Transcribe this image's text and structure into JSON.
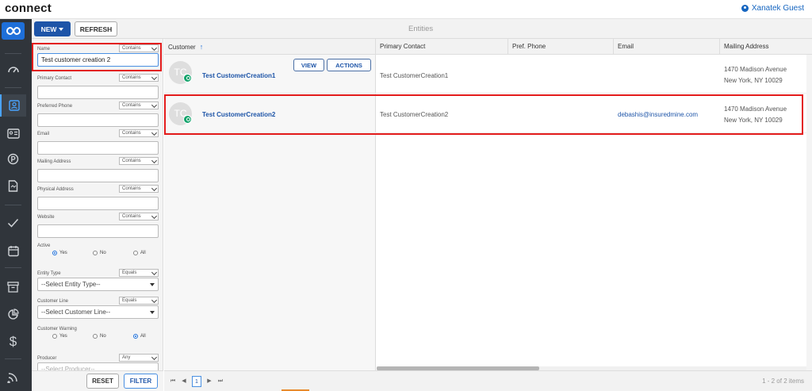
{
  "app": {
    "logo": "connect",
    "user_name": "Xanatek Guest"
  },
  "toolbar": {
    "new_label": "NEW",
    "refresh_label": "REFRESH",
    "title": "Entities"
  },
  "rail_icons": [
    "dashboard-icon",
    "contacts-icon",
    "id-card-icon",
    "policy-icon",
    "document-icon",
    "check-icon",
    "calendar-icon",
    "archive-icon",
    "reports-icon",
    "dollar-icon",
    "signal-icon"
  ],
  "filters": {
    "name": {
      "label": "Name",
      "op": "Contains",
      "value": "Test  customer creation 2"
    },
    "primary_contact": {
      "label": "Primary Contact",
      "op": "Contains",
      "value": ""
    },
    "preferred_phone": {
      "label": "Preferred Phone",
      "op": "Contains",
      "value": ""
    },
    "email": {
      "label": "Email",
      "op": "Contains",
      "value": ""
    },
    "mailing_address": {
      "label": "Mailing Address",
      "op": "Contains",
      "value": ""
    },
    "physical_address": {
      "label": "Physical Address",
      "op": "Contains",
      "value": ""
    },
    "website": {
      "label": "Website",
      "op": "Contains",
      "value": ""
    },
    "active": {
      "label": "Active",
      "options": [
        "Yes",
        "No",
        "All"
      ],
      "selected": "Yes"
    },
    "entity_type": {
      "label": "Entity Type",
      "op": "Equals",
      "value": "--Select Entity Type--"
    },
    "customer_line": {
      "label": "Customer Line",
      "op": "Equals",
      "value": "--Select Customer Line--"
    },
    "customer_warning": {
      "label": "Customer Warning",
      "options": [
        "Yes",
        "No",
        "All"
      ],
      "selected": "All"
    },
    "producer": {
      "label": "Producer",
      "op": "Any",
      "value": "--Select Producer--"
    },
    "reset_label": "RESET",
    "filter_label": "FILTER"
  },
  "grid": {
    "columns": [
      "Customer",
      "Primary Contact",
      "Pref. Phone",
      "Email",
      "Mailing Address"
    ],
    "view_label": "VIEW",
    "actions_label": "ACTIONS",
    "rows": [
      {
        "initials": "TC",
        "customer": "Test CustomerCreation1",
        "primary_contact": "Test CustomerCreation1",
        "pref_phone": "",
        "email": "",
        "address_line1": "1470 Madison Avenue",
        "address_line2": "New York, NY 10029"
      },
      {
        "initials": "TC",
        "customer": "Test CustomerCreation2",
        "primary_contact": "Test CustomerCreation2",
        "pref_phone": "",
        "email": "debashis@insuredmine.com",
        "address_line1": "1470 Madison Avenue",
        "address_line2": "New York, NY 10029"
      }
    ]
  },
  "pager": {
    "current_page": "1",
    "info": "1 - 2 of 2 items"
  },
  "colors": {
    "accent": "#1e55a8",
    "rail": "#30353b",
    "highlight": "#e31b1b"
  }
}
